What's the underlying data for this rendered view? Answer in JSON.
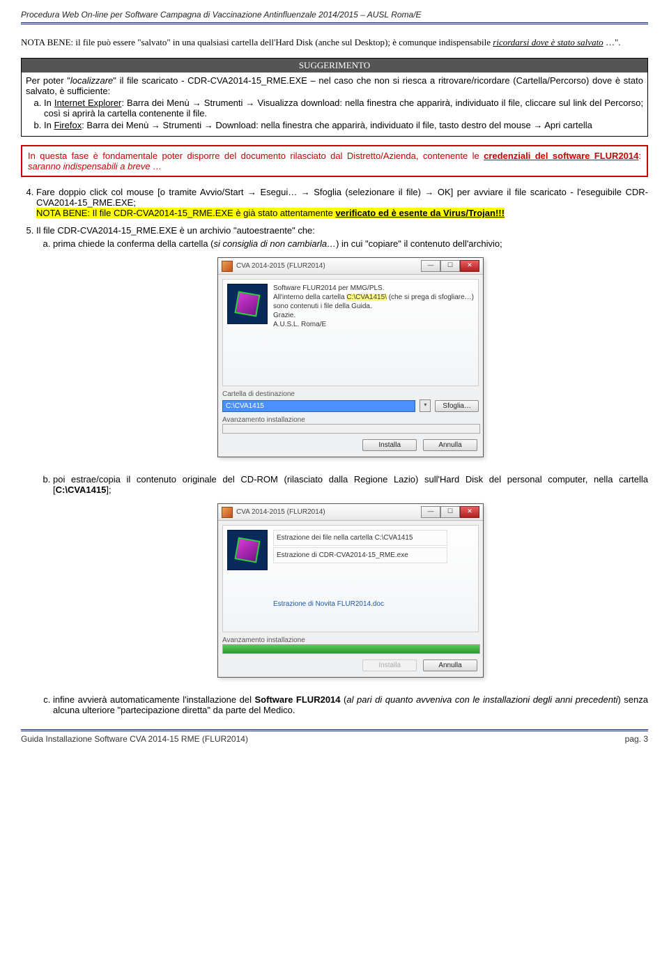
{
  "header": "Procedura Web On-line per Software Campagna di Vaccinazione Antinfluenzale 2014/2015 – AUSL Roma/E",
  "nota": {
    "prefix": "NOTA BENE: il file può essere \"salvato\" in una qualsiasi cartella dell'Hard Disk (anche sul Desktop); è comunque indispensabile ",
    "emph": "ricordarsi dove è stato salvato",
    "suffix": " …\"."
  },
  "sugg": {
    "title": "SUGGERIMENTO",
    "intro_a": "Per poter \"",
    "intro_b": "localizzare",
    "intro_c": "\" il file scaricato - CDR-CVA2014-15_RME.EXE – nel caso che non si riesca a ritrovare/ricordare (Cartella/Percorso) dove è stato salvato, è sufficiente:",
    "a_pre": "In ",
    "a_link": "Internet Explorer",
    "a_post": ": Barra dei Menù → Strumenti → Visualizza download: nella finestra che apparirà, individuato il file, cliccare sul link del Percorso; così si aprirà la cartella contenente il file.",
    "b_pre": "In ",
    "b_link": "Firefox",
    "b_post": ": Barra dei Menù → Strumenti → Download: nella finestra che apparirà, individuato il file, tasto destro del mouse → Apri cartella"
  },
  "redbox": {
    "line1_a": "In questa fase è fondamentale poter disporre del documento rilasciato dal Distretto/Azienda, contenente le ",
    "line1_b": "credenziali del software FLUR2014",
    "line1_c": ": ",
    "line1_d": "saranno indispensabili a breve …"
  },
  "step4": {
    "main": "Fare doppio click col mouse [o tramite Avvio/Start → Esegui… → Sfoglia (selezionare il file) → OK] per avviare il file scaricato - l'eseguibile CDR-CVA2014-15_RME.EXE;",
    "nota_a": "NOTA BENE: Il file CDR-CVA2014-15_RME.EXE è già stato attentamente ",
    "nota_b": "verificato ed è esente da Virus/Trojan!!!"
  },
  "step5": {
    "intro": "Il file CDR-CVA2014-15_RME.EXE è un archivio \"autoestraente\" che:",
    "a_pre": "prima chiede la conferma della cartella (",
    "a_it": "si consiglia di non cambiarla…",
    "a_post": ") in cui \"copiare\" il contenuto dell'archivio;",
    "b_pre": "poi estrae/copia il contenuto originale del CD-ROM (rilasciato dalla Regione Lazio) sull'Hard Disk del personal computer, nella cartella [",
    "b_bold": "C:\\CVA1415",
    "b_post": "];",
    "c_pre": "infine avvierà automaticamente l'installazione del ",
    "c_bold": "Software FLUR2014",
    "c_mid": " (",
    "c_it": "al pari di quanto avveniva con le installazioni degli anni precedenti",
    "c_post": ") senza alcuna ulteriore \"partecipazione diretta\" da parte del Medico."
  },
  "dialog1": {
    "title": "CVA 2014-2015 (FLUR2014)",
    "line1": "Software FLUR2014 per MMG/PLS.",
    "line2a": "All'interno della cartella ",
    "line2b": "C:\\CVA1415\\",
    "line2c": " (che si prega di sfogliare…) sono contenuti i file della Guida.",
    "line3": "Grazie.",
    "line4": "A.U.S.L. Roma/E",
    "dest_label": "Cartella di destinazione",
    "dest_value": "C:\\CVA1415",
    "browse": "Sfoglia…",
    "progress_label": "Avanzamento installazione",
    "install": "Installa",
    "cancel": "Annulla"
  },
  "dialog2": {
    "title": "CVA 2014-2015 (FLUR2014)",
    "line1": "Estrazione dei file nella cartella C:\\CVA1415",
    "line2": "Estrazione di CDR-CVA2014-15_RME.exe",
    "extract_label": "Estrazione di Novita FLUR2014.doc",
    "progress_label": "Avanzamento installazione",
    "install": "Installa",
    "cancel": "Annulla"
  },
  "footer": {
    "left": "Guida Installazione Software CVA 2014-15 RME (FLUR2014)",
    "right": "pag. 3"
  }
}
